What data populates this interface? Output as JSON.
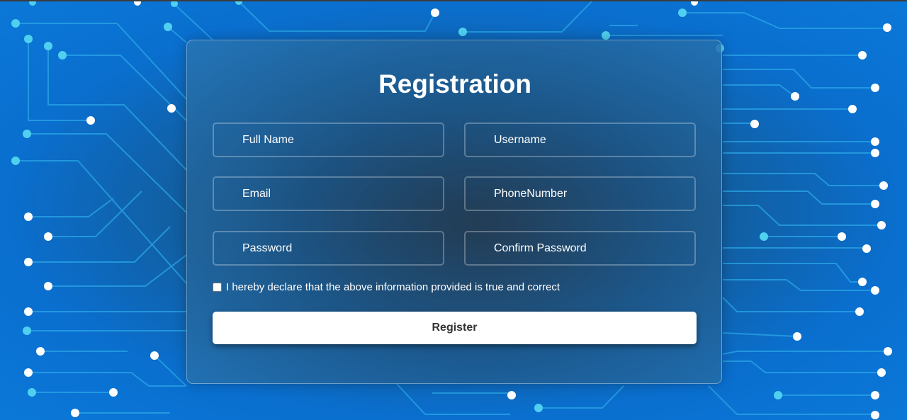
{
  "form": {
    "title": "Registration",
    "fields": {
      "full_name": {
        "placeholder": "Full Name",
        "value": ""
      },
      "username": {
        "placeholder": "Username",
        "value": ""
      },
      "email": {
        "placeholder": "Email",
        "value": ""
      },
      "phone": {
        "placeholder": "PhoneNumber",
        "value": ""
      },
      "password": {
        "placeholder": "Password",
        "value": ""
      },
      "confirm_password": {
        "placeholder": "Confirm Password",
        "value": ""
      }
    },
    "declaration": {
      "label": "I hereby declare that the above information provided is true and correct",
      "checked": false
    },
    "register_label": "Register"
  },
  "colors": {
    "background_blue": "#0b78d8",
    "circuit_line": "#2aa6e6",
    "circuit_node_cyan": "#4fd0f0",
    "circuit_node_white": "#ffffff",
    "button_bg": "#ffffff",
    "button_text": "#333333"
  }
}
